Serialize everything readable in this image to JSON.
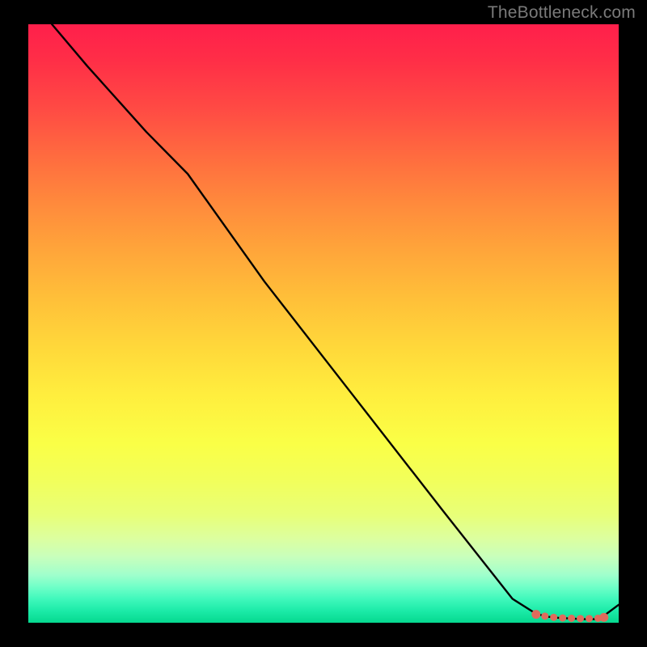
{
  "watermark": "TheBottleneck.com",
  "chart_data": {
    "type": "line",
    "title": "",
    "xlabel": "",
    "ylabel": "",
    "xlim": [
      0,
      100
    ],
    "ylim": [
      0,
      100
    ],
    "grid": false,
    "series": [
      {
        "name": "curve",
        "color_hex": "#000000",
        "x": [
          4,
          10,
          20,
          27,
          40,
          55,
          70,
          82,
          86,
          88,
          90,
          92,
          94,
          96,
          97,
          100
        ],
        "values": [
          100,
          93,
          82,
          75,
          57,
          38,
          19,
          4,
          1.5,
          1,
          0.8,
          0.7,
          0.6,
          0.6,
          0.8,
          3
        ]
      }
    ],
    "markers": {
      "name": "dotted-segment",
      "color_hex": "#e06b5c",
      "x": [
        86,
        87.5,
        89,
        90.5,
        92,
        93.5,
        95,
        96.5,
        97.5
      ],
      "values": [
        1.4,
        1.1,
        0.9,
        0.8,
        0.75,
        0.7,
        0.7,
        0.75,
        0.9
      ]
    }
  }
}
